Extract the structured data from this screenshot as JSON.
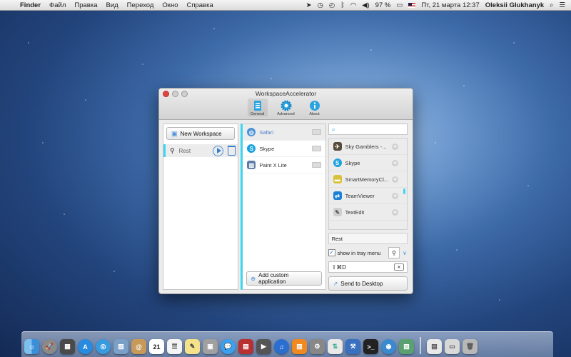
{
  "menubar": {
    "items": [
      "Finder",
      "Файл",
      "Правка",
      "Вид",
      "Переход",
      "Окно",
      "Справка"
    ],
    "battery": "97 %",
    "datetime": "Пт, 21 марта  12:37",
    "user": "Oleksii Glukhanyk"
  },
  "window": {
    "title": "WorkspaceAccelerator",
    "toolbar": {
      "general": "General",
      "advanced": "Advanced",
      "about": "About"
    }
  },
  "workspaces": {
    "new_label": "New Workspace",
    "items": [
      {
        "name": "Rest"
      }
    ]
  },
  "ws_apps": {
    "items": [
      {
        "label": "Safari",
        "icon": "safari-icon",
        "color": "#4a90d9"
      },
      {
        "label": "Skype",
        "icon": "skype-icon",
        "color": "#1aa2e0"
      },
      {
        "label": "Paint X Lite",
        "icon": "paint-icon",
        "color": "#5b7aa6"
      }
    ],
    "add_custom": "Add custom application"
  },
  "available_apps": {
    "search_placeholder": "",
    "items": [
      {
        "label": "Sky Gamblers -...",
        "icon": "game-icon",
        "color": "#5a4a3a"
      },
      {
        "label": "Skype",
        "icon": "skype-icon",
        "color": "#1aa2e0"
      },
      {
        "label": "SmartMemoryCl...",
        "icon": "memory-icon",
        "color": "#d9c23a"
      },
      {
        "label": "TeamViewer",
        "icon": "teamviewer-icon",
        "color": "#1a7fd6"
      },
      {
        "label": "TextEdit",
        "icon": "textedit-icon",
        "color": "#cfcfcf"
      }
    ]
  },
  "settings": {
    "workspace_name": "Rest",
    "tray_label": "show in tray menu",
    "tray_checked": true,
    "hotkey": "⇧⌘D",
    "send_label": "Send to Desktop"
  },
  "dock": {
    "calendar_day": "21"
  }
}
